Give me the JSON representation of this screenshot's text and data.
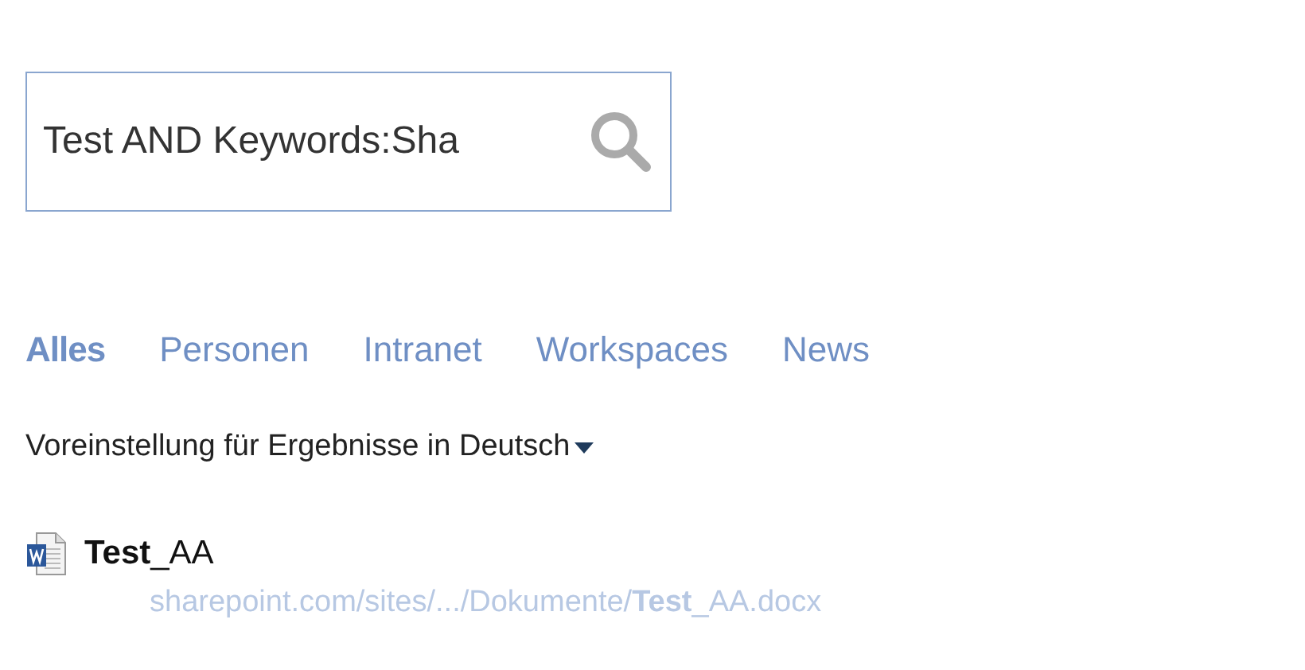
{
  "search": {
    "value": "Test AND Keywords:Sha"
  },
  "tabs": [
    {
      "label": "Alles",
      "selected": true
    },
    {
      "label": "Personen",
      "selected": false
    },
    {
      "label": "Intranet",
      "selected": false
    },
    {
      "label": "Workspaces",
      "selected": false
    },
    {
      "label": "News",
      "selected": false
    }
  ],
  "language_filter": {
    "label": "Voreinstellung für Ergebnisse in Deutsch"
  },
  "results": [
    {
      "kind": "word",
      "title": "**Test**_AA",
      "url": "sharepoint.com/sites/.../Dokumente/**Test**_AA.docx"
    }
  ]
}
